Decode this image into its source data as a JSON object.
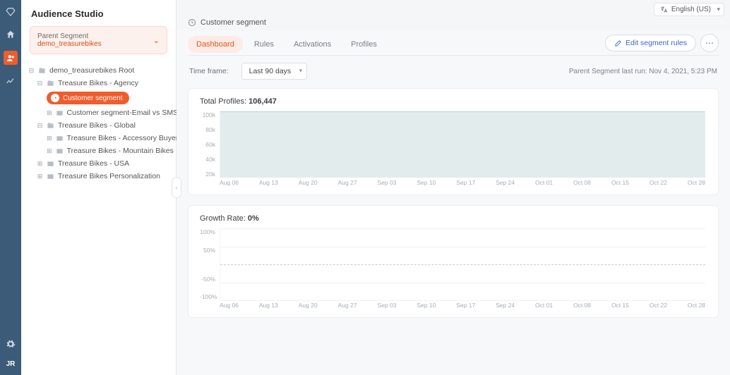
{
  "rail": {
    "avatar": "JR"
  },
  "sidebar": {
    "title": "Audience Studio",
    "parent": {
      "label": "Parent Segment",
      "value": "demo_treasurebikes"
    },
    "tree": {
      "root": "demo_treasurebikes Root",
      "n1": "Treasure Bikes - Agency",
      "pill": "Customer segment",
      "n1a": "Customer segment-Email vs SMS",
      "n2": "Treasure Bikes - Global",
      "n2a": "Treasure Bikes - Accessory Buyers",
      "n2b": "Treasure Bikes - Mountain Bikes",
      "n3": "Treasure Bikes - USA",
      "n4": "Treasure Bikes Personalization"
    }
  },
  "lang": "English (US)",
  "crumb": "Customer segment",
  "tabs": [
    "Dashboard",
    "Rules",
    "Activations",
    "Profiles"
  ],
  "edit_label": "Edit segment rules",
  "timeframe": {
    "label": "Time frame:",
    "value": "Last 90 days"
  },
  "lastrun": "Parent Segment last run: Nov 4, 2021, 5:23 PM",
  "chart_data": [
    {
      "type": "area",
      "title_prefix": "Total Profiles: ",
      "title_value": "106,447",
      "yticks": [
        "100k",
        "80k",
        "60k",
        "40k",
        "20k"
      ],
      "ylim": [
        0,
        100000
      ],
      "categories": [
        "Aug 06",
        "Aug 13",
        "Aug 20",
        "Aug 27",
        "Sep 03",
        "Sep 10",
        "Sep 17",
        "Sep 24",
        "Oct 01",
        "Oct 08",
        "Oct 15",
        "Oct 22",
        "Oct 28"
      ],
      "values": [
        106447,
        106447,
        106447,
        106447,
        106447,
        106447,
        106447,
        106447,
        106447,
        106447,
        106447,
        106447,
        106447
      ]
    },
    {
      "type": "line",
      "title_prefix": "Growth Rate: ",
      "title_value": "0%",
      "yticks": [
        "100%",
        "50%",
        "",
        "-50%",
        "-100%"
      ],
      "ylim": [
        -100,
        100
      ],
      "categories": [
        "Aug 06",
        "Aug 13",
        "Aug 20",
        "Aug 27",
        "Sep 03",
        "Sep 10",
        "Sep 17",
        "Sep 24",
        "Oct 01",
        "Oct 08",
        "Oct 15",
        "Oct 22",
        "Oct 28"
      ],
      "values": [
        0,
        0,
        0,
        0,
        0,
        0,
        0,
        0,
        0,
        0,
        0,
        0,
        0
      ]
    }
  ]
}
